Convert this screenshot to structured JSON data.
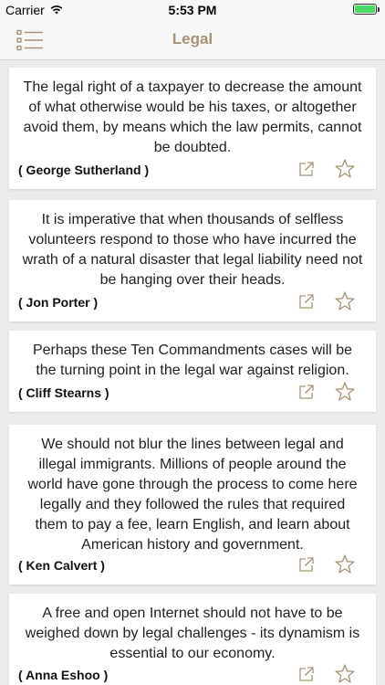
{
  "status_bar": {
    "carrier": "Carrier",
    "time": "5:53 PM",
    "battery_level": 1.0,
    "battery_color": "#4cd964"
  },
  "nav": {
    "title": "Legal",
    "menu_icon": "list-icon",
    "accent_color": "#a89377"
  },
  "cards": [
    {
      "quote": "The legal right of a taxpayer to decrease the amount of what otherwise would be his taxes, or altogether avoid them, by means which the law permits, cannot be doubted.",
      "author": "( George Sutherland )",
      "share_icon": "share-icon",
      "favorite_icon": "star-icon"
    },
    {
      "quote": "It is imperative that when thousands of selfless volunteers respond to those who have incurred the wrath of a natural disaster that legal liability need not be hanging over their heads.",
      "author": "( Jon Porter )",
      "share_icon": "share-icon",
      "favorite_icon": "star-icon"
    },
    {
      "quote": "Perhaps these Ten Commandments cases will be the turning point in the legal war against religion.",
      "author": "( Cliff Stearns )",
      "share_icon": "share-icon",
      "favorite_icon": "star-icon"
    },
    {
      "quote": "We should not blur the lines between legal and illegal immigrants. Millions of people around the world have gone through the process to come here legally and they followed the rules that required them to pay a fee, learn English, and learn about American history and government.",
      "author": "( Ken Calvert )",
      "share_icon": "share-icon",
      "favorite_icon": "star-icon"
    },
    {
      "quote": "A free and open Internet should not have to be weighed down by legal challenges - its dynamism is essential to our economy.",
      "author": "( Anna Eshoo )",
      "share_icon": "share-icon",
      "favorite_icon": "star-icon"
    }
  ]
}
